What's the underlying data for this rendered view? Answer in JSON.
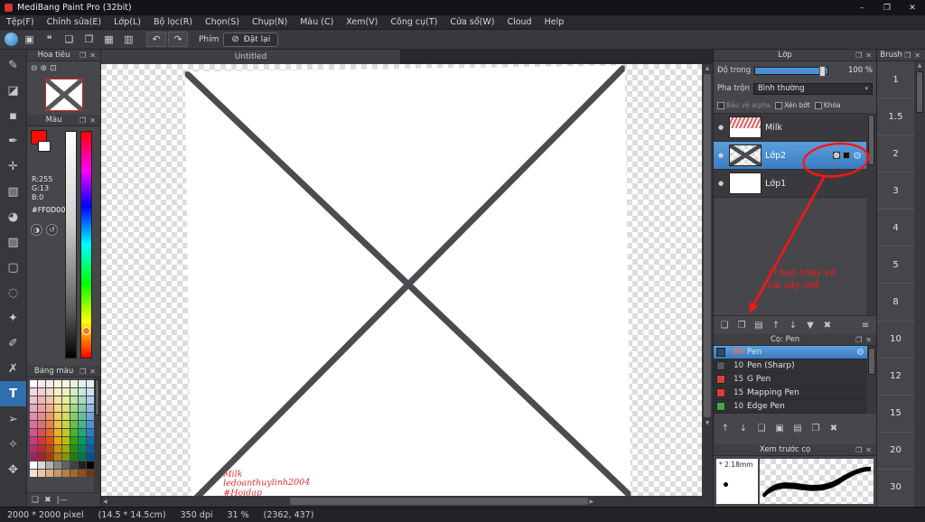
{
  "window": {
    "title": "MediBang Paint Pro (32bit)"
  },
  "menubar": {
    "items": [
      "Tệp(F)",
      "Chỉnh sửa(E)",
      "Lớp(L)",
      "Bộ lọc(R)",
      "Chọn(S)",
      "Chụp(N)",
      "Màu (C)",
      "Xem(V)",
      "Công cụ(T)",
      "Cửa sổ(W)",
      "Cloud",
      "Help"
    ]
  },
  "toolbar": {
    "icons": [
      {
        "name": "medibang-logo-icon",
        "glyph": "",
        "logo": true
      },
      {
        "name": "save-icon",
        "glyph": "▣"
      },
      {
        "name": "comment-icon",
        "glyph": "❝"
      },
      {
        "name": "new-document-icon",
        "glyph": "❏"
      },
      {
        "name": "export-icon",
        "glyph": "❐"
      },
      {
        "name": "grid-view-icon",
        "glyph": "▦"
      },
      {
        "name": "workspace-icon",
        "glyph": "▥"
      }
    ],
    "keys_label": "Phím",
    "reset_button": "Đặt lại"
  },
  "tools": [
    {
      "name": "brush-tool",
      "glyph": "✎"
    },
    {
      "name": "eraser-tool",
      "glyph": "◪"
    },
    {
      "name": "dot-pen-tool",
      "glyph": "▪"
    },
    {
      "name": "pen-tool",
      "glyph": "✒"
    },
    {
      "name": "move-tool",
      "glyph": "✛"
    },
    {
      "name": "fill-tool",
      "glyph": "▧"
    },
    {
      "name": "bucket-tool",
      "glyph": "◕"
    },
    {
      "name": "gradient-tool",
      "glyph": "▨"
    },
    {
      "name": "select-tool",
      "glyph": "▢"
    },
    {
      "name": "lasso-tool",
      "glyph": "◌"
    },
    {
      "name": "magic-wand-tool",
      "glyph": "✦"
    },
    {
      "name": "select-pen-tool",
      "glyph": "✐"
    },
    {
      "name": "select-eraser-tool",
      "glyph": "✗"
    },
    {
      "name": "text-tool",
      "glyph": "T",
      "active": true
    },
    {
      "name": "operation-tool",
      "glyph": "➢"
    },
    {
      "name": "eyedropper-tool",
      "glyph": "✧"
    },
    {
      "name": "hand-tool",
      "glyph": "✥"
    }
  ],
  "navigator": {
    "title": "Hoa tiêu"
  },
  "color_panel": {
    "title": "Màu",
    "r": "R:255",
    "g": "G:13",
    "b": "B:0",
    "hex": "#FF0D00"
  },
  "palette_panel": {
    "title": "Bảng màu",
    "colors": [
      [
        "#ffffff",
        "#fbe9e7",
        "#fde7ef",
        "#fff8dc",
        "#f3f8d8",
        "#e4f3dc",
        "#dff1ec",
        "#e3eefa"
      ],
      [
        "#f6d7dd",
        "#f8cdd3",
        "#fadcc6",
        "#fcefc0",
        "#eef3bd",
        "#d6edc6",
        "#c7e9da",
        "#cfe1f4"
      ],
      [
        "#f0c0d2",
        "#f4b2ba",
        "#f7c6a6",
        "#fae3a2",
        "#e7ee9e",
        "#bfe5ab",
        "#a8dcc6",
        "#b0cfec"
      ],
      [
        "#eaa8c2",
        "#eea0a8",
        "#f2af86",
        "#f6d884",
        "#dce67c",
        "#a0d98d",
        "#85ceb3",
        "#8fbbe3"
      ],
      [
        "#e38cb1",
        "#e8888f",
        "#ee9767",
        "#f2cb65",
        "#d1dd5d",
        "#83cd6d",
        "#63c19f",
        "#6da7d9"
      ],
      [
        "#dd70a0",
        "#e26e73",
        "#ea7f47",
        "#eebf45",
        "#c7d53d",
        "#65c14d",
        "#41b58b",
        "#4993cf"
      ],
      [
        "#d5548f",
        "#dc5055",
        "#e66727",
        "#eab325",
        "#becd1f",
        "#47b52d",
        "#1fa977",
        "#277fc5"
      ],
      [
        "#cd3880",
        "#d63639",
        "#e24f07",
        "#e6a705",
        "#b3c501",
        "#29a90f",
        "#009d63",
        "#096bbb"
      ],
      [
        "#b52c71",
        "#bc2c31",
        "#c64505",
        "#ca9303",
        "#9dad01",
        "#23950d",
        "#008957",
        "#075da3"
      ],
      [
        "#9d2461",
        "#a42429",
        "#ac3b03",
        "#b07f03",
        "#879501",
        "#1d810b",
        "#00774b",
        "#054f8b"
      ],
      [
        "#ffffff",
        "#d8d8d8",
        "#b0b0b0",
        "#888888",
        "#606060",
        "#404040",
        "#202020",
        "#000000"
      ],
      [
        "#f8e0d0",
        "#e8c8a8",
        "#d8b088",
        "#c89868",
        "#b88048",
        "#a06830",
        "#885020",
        "#703810"
      ]
    ],
    "buttons": [
      {
        "name": "add-palette-color-button",
        "glyph": "❏"
      },
      {
        "name": "delete-palette-color-button",
        "glyph": "✖"
      },
      {
        "name": "palette-options-button",
        "glyph": "|—"
      }
    ]
  },
  "document": {
    "tab": "Untitled",
    "watermark_lines": [
      "Milk",
      "ledoanthuylinh2004",
      "#Hoidap"
    ]
  },
  "layer_panel": {
    "title": "Lớp",
    "opacity_label": "Độ trong",
    "opacity_value": "100 %",
    "blend_label": "Pha trộn",
    "blend_value": "Bình thường",
    "protect_alpha": "Bảo vệ alpha",
    "clipping": "Xén bớt",
    "lock": "Khóa",
    "layers": [
      {
        "name": "Milk",
        "selected": false,
        "thumb": "milk"
      },
      {
        "name": "Lớp2",
        "selected": true,
        "thumb": "cross"
      },
      {
        "name": "Lớp1",
        "selected": false,
        "thumb": "white"
      }
    ],
    "buttons": [
      {
        "name": "new-layer-button",
        "glyph": "❏"
      },
      {
        "name": "duplicate-layer-button",
        "glyph": "❐"
      },
      {
        "name": "new-folder-button",
        "glyph": "▤"
      },
      {
        "name": "move-layer-up-button",
        "glyph": "↑"
      },
      {
        "name": "move-layer-down-button",
        "glyph": "↓"
      },
      {
        "name": "merge-layer-button",
        "glyph": "▼"
      },
      {
        "name": "delete-layer-button",
        "glyph": "✖"
      },
      {
        "name": "layer-menu-button",
        "glyph": "≡",
        "right": true
      }
    ],
    "annotation": {
      "lines": [
        "Vì bạn nháy vô",
        "cái này nek"
      ]
    }
  },
  "brush_panel": {
    "title": "Cọ: Pen",
    "brushes": [
      {
        "size": "30",
        "name": "Pen",
        "selected": true,
        "chip": "#2a4a6e"
      },
      {
        "size": "10",
        "name": "Pen (Sharp)",
        "selected": false,
        "chip": "#555861"
      },
      {
        "size": "15",
        "name": "G Pen",
        "selected": false,
        "chip": "#d84040"
      },
      {
        "size": "15",
        "name": "Mapping Pen",
        "selected": false,
        "chip": "#d84040"
      },
      {
        "size": "10",
        "name": "Edge Pen",
        "selected": false,
        "chip": "#43a843"
      }
    ],
    "buttons": [
      {
        "name": "brush-up-button",
        "glyph": "↑"
      },
      {
        "name": "brush-down-button",
        "glyph": "↓"
      },
      {
        "name": "add-brush-button",
        "glyph": "❏"
      },
      {
        "name": "save-brush-button",
        "glyph": "▣"
      },
      {
        "name": "brush-folder-button",
        "glyph": "▤"
      },
      {
        "name": "duplicate-brush-button",
        "glyph": "❐"
      },
      {
        "name": "delete-brush-button",
        "glyph": "✖"
      }
    ]
  },
  "preview_panel": {
    "title": "Xem trước cọ",
    "size_label": "2.18mm"
  },
  "sizes_panel": {
    "title": "Brush",
    "sizes": [
      "1",
      "1.5",
      "2",
      "3",
      "4",
      "5",
      "8",
      "10",
      "12",
      "15",
      "20",
      "30"
    ]
  },
  "statusbar": {
    "dimensions": "2000 * 2000 pixel",
    "physical": "(14.5 * 14.5cm)",
    "dpi": "350 dpi",
    "zoom": "31 %",
    "cursor": "(2362, 437)"
  },
  "icons": {
    "popout": "❐",
    "close": "✕",
    "minimize": "–",
    "restore": "❐",
    "undo": "↶",
    "redo": "↷",
    "no_entry": "⊘",
    "down_arrow": "▾",
    "eye": "●",
    "gear": "⚙",
    "zoom_out": "⊖",
    "zoom_in": "⊕",
    "fit": "⊡",
    "swap_colors": "◑",
    "reset_colors": "↺",
    "up_arrow_small": "▲",
    "down_arrow_small": "▼",
    "left_arrow_small": "◀",
    "right_arrow_small": "▶",
    "star": "*"
  },
  "colors": {
    "accent_blue": "#3f86cc",
    "selection_blue": "#4b8fd0",
    "annotation_red": "#ff1515",
    "current_color": "#FF0D00"
  }
}
